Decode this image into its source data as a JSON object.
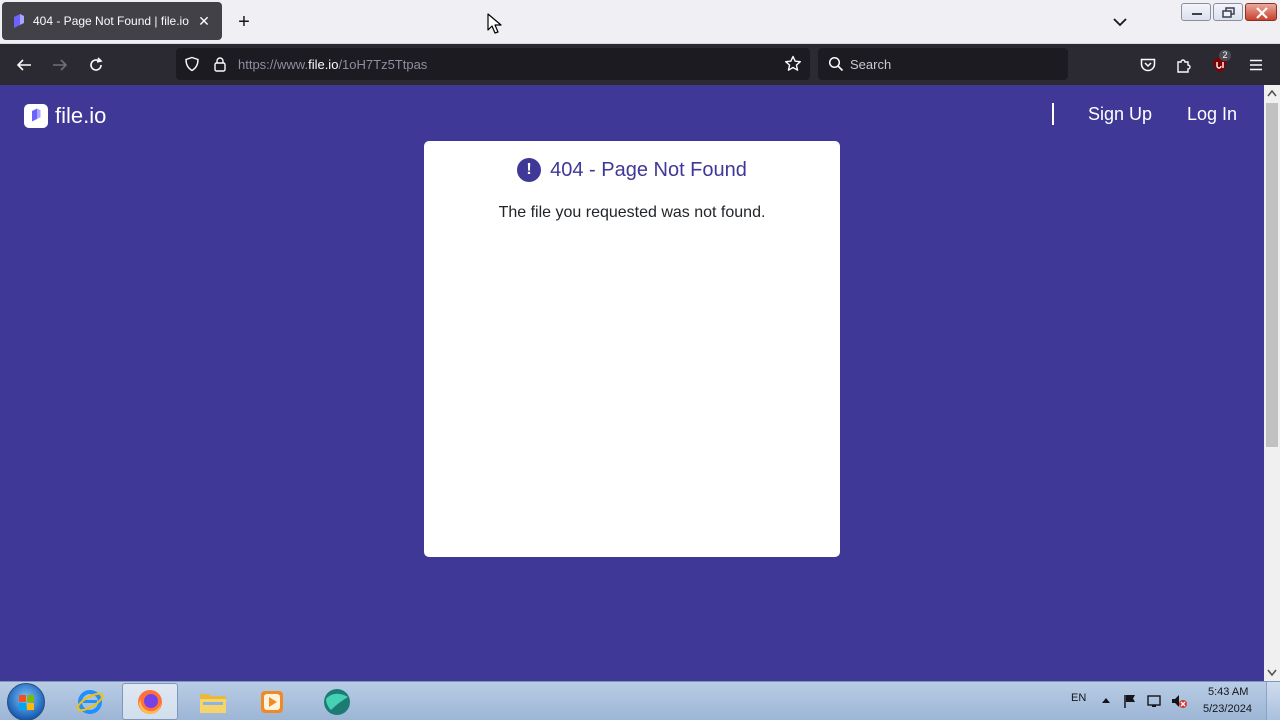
{
  "browser": {
    "tab": {
      "title": "404 - Page Not Found | file.io",
      "close": "✕"
    },
    "new_tab": "+",
    "url": {
      "prefix": "https://www.",
      "host": "file.io",
      "path": "/1oH7Tz5Ttpas"
    },
    "search": {
      "placeholder": "Search"
    },
    "extension_badge": "2",
    "icons": [
      "back-icon",
      "forward-icon",
      "reload-icon",
      "shield-icon",
      "lock-icon",
      "star-icon",
      "search-icon",
      "pocket-icon",
      "extensions-icon",
      "ublock-icon",
      "menu-icon"
    ]
  },
  "site": {
    "logo_text": "file.io",
    "nav": {
      "sign_up": "Sign Up",
      "log_in": "Log In"
    },
    "card": {
      "title": "404 - Page Not Found",
      "message": "The file you requested was not found.",
      "icon_glyph": "!"
    }
  },
  "taskbar": {
    "language": "EN",
    "time": "5:43 AM",
    "date": "5/23/2024",
    "apps": [
      "internet-explorer-icon",
      "firefox-icon",
      "file-explorer-icon",
      "media-player-icon",
      "globe-app-icon"
    ]
  },
  "colors": {
    "page_bg": "#3f3897",
    "accent": "#3f3897",
    "toolbar": "#2b2a33"
  }
}
